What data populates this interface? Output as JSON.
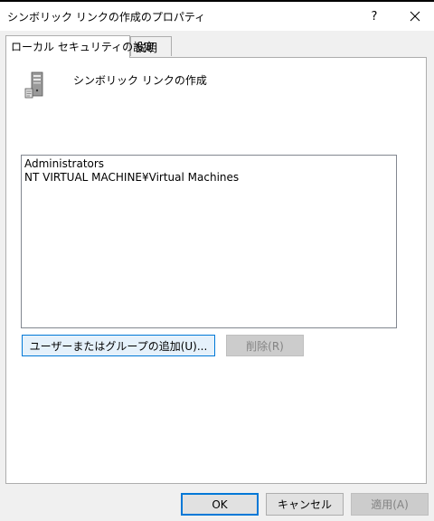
{
  "window": {
    "title": "シンボリック リンクの作成のプロパティ",
    "help_label": "?"
  },
  "tabs": [
    {
      "label": "ローカル セキュリティの設定",
      "active": true
    },
    {
      "label": "説明",
      "active": false
    }
  ],
  "policy": {
    "name": "シンボリック リンクの作成",
    "icon": "server-policy-icon"
  },
  "members": [
    "Administrators",
    "NT VIRTUAL MACHINE¥Virtual Machines"
  ],
  "buttons": {
    "add": "ユーザーまたはグループの追加(U)...",
    "remove": "削除(R)",
    "ok": "OK",
    "cancel": "キャンセル",
    "apply": "適用(A)"
  },
  "colors": {
    "focus_accent": "#0078d7",
    "disabled_text": "#838383"
  }
}
